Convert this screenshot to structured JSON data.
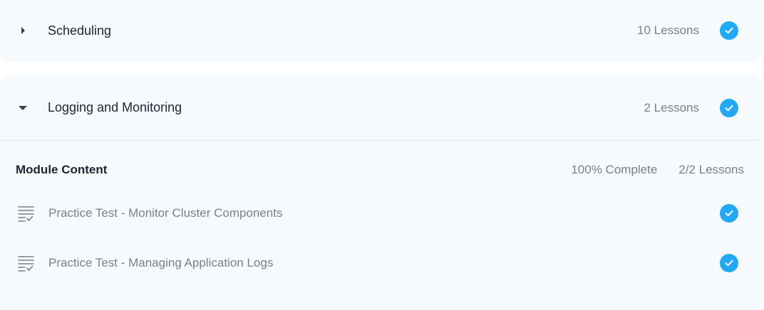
{
  "modules": [
    {
      "title": "Scheduling",
      "lesson_count": "10 Lessons",
      "state": "collapsed",
      "completed": true
    },
    {
      "title": "Logging and Monitoring",
      "lesson_count": "2 Lessons",
      "state": "expanded",
      "completed": true,
      "content": {
        "heading": "Module Content",
        "progress": "100% Complete",
        "lessons_done": "2/2 Lessons",
        "lessons": [
          {
            "title": "Practice Test - Monitor Cluster Components",
            "completed": true
          },
          {
            "title": "Practice Test - Managing Application Logs",
            "completed": true
          }
        ]
      }
    }
  ],
  "colors": {
    "check": "#21a9f3",
    "panel_bg": "#f6fafd",
    "muted_text": "#7a808a",
    "title_text": "#1d2433"
  },
  "icons": {
    "collapsed_caret": "caret-right-icon",
    "expanded_caret": "caret-down-icon",
    "completed": "check-circle-icon",
    "lesson": "checklist-icon"
  }
}
